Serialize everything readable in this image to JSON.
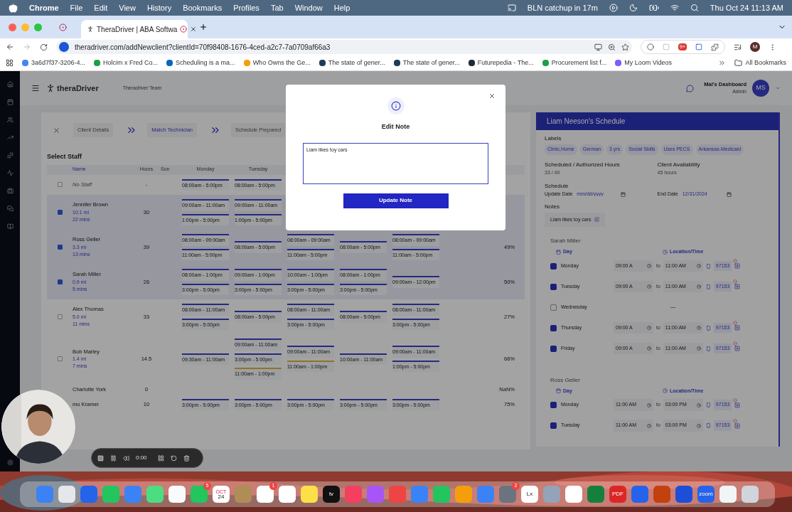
{
  "menubar": {
    "app": "Chrome",
    "menus": [
      "File",
      "Edit",
      "View",
      "History",
      "Bookmarks",
      "Profiles",
      "Tab",
      "Window",
      "Help"
    ],
    "event": "BLN catchup in 17m",
    "clock": "Thu Oct 24  11:13 AM"
  },
  "browser": {
    "tab": "TheraDriver | ABA Softwa",
    "url": "theradriver.com/addNewclient?clientId=70f98408-1676-4ced-a2c7-7a0709af66a3",
    "extension_badge": "9+",
    "profile": "M",
    "bookmarks": [
      {
        "label": "3a6d7f37-3206-4...",
        "color": "#4285f4"
      },
      {
        "label": "Holcim x Fred Co...",
        "color": "#1e9e4a"
      },
      {
        "label": "Scheduling is a ma...",
        "color": "#0a66c2"
      },
      {
        "label": "Who Owns the Ge...",
        "color": "#f59e0b"
      },
      {
        "label": "The state of gener...",
        "color": "#1f3a5f"
      },
      {
        "label": "The state of gener...",
        "color": "#1f3a5f"
      },
      {
        "label": "Futurepedia - The...",
        "color": "#1e293b"
      },
      {
        "label": "Procurement list f...",
        "color": "#1e9e4a"
      },
      {
        "label": "My Loom Videos",
        "color": "#7c5cff"
      }
    ],
    "all_bookmarks": "All Bookmarks"
  },
  "app": {
    "logo": "theraDriver",
    "team": "Theradriver Team",
    "user_name": "Mal's Dashboard",
    "user_role": "Admin",
    "initials": "MS"
  },
  "steps": [
    {
      "label": "Client Details",
      "selected": false
    },
    {
      "label": "Match Technician",
      "selected": true
    },
    {
      "label": "Schedule Prepared",
      "selected": false
    }
  ],
  "staff_table": {
    "title": "Select Staff",
    "columns": [
      "Name",
      "Hours",
      "Sun",
      "Monday",
      "Tuesday"
    ],
    "rows": [
      {
        "name": "No Staff",
        "hours": "-",
        "checked": false,
        "mon": [
          {
            "time": "08:00am - 5:00pm",
            "kind": "open"
          }
        ],
        "tue": [
          {
            "time": "08:00am - 5:00pm",
            "kind": "open"
          }
        ]
      },
      {
        "name": "Jennifer Brown",
        "distance": "10.1 mi",
        "travel": "22 mins",
        "hours": "30",
        "checked": true,
        "mon": [
          {
            "time": "09:00am - 11:00am",
            "kind": "open"
          },
          {
            "time": "1:00pm - 5:00pm",
            "kind": "open"
          }
        ],
        "tue": [
          {
            "time": "09:00am - 11:00am",
            "kind": "open"
          },
          {
            "time": "1:00pm - 5:00pm",
            "kind": "open"
          }
        ]
      },
      {
        "name": "Ross Geller",
        "distance": "3.3 mi",
        "travel": "13 mins",
        "hours": "39",
        "checked": true,
        "percent": "49%",
        "mon": [
          {
            "time": "08:00am - 09:00am",
            "kind": "open"
          },
          {
            "time": "11:00am - 5:00pm",
            "kind": "open"
          }
        ],
        "tue": [
          {
            "time": "08:00am - 5:00pm",
            "kind": "open"
          }
        ],
        "wed": [
          {
            "time": "08:00am - 09:00am",
            "kind": "open"
          },
          {
            "time": "11:00am - 5:00pm",
            "kind": "open"
          }
        ],
        "thu": [
          {
            "time": "08:00am - 5:00pm",
            "kind": "open"
          }
        ],
        "fri": [
          {
            "time": "08:00am - 09:00am",
            "kind": "open"
          },
          {
            "time": "11:00am - 5:00pm",
            "kind": "open"
          }
        ]
      },
      {
        "name": "Sarah Miller",
        "distance": "0.9 mi",
        "travel": "5 mins",
        "hours": "26",
        "checked": true,
        "percent": "50%",
        "mon": [
          {
            "time": "08:00am - 1:00pm",
            "kind": "open"
          },
          {
            "time": "3:00pm - 5:00pm",
            "kind": "open"
          }
        ],
        "tue": [
          {
            "time": "09:00am - 1:00pm",
            "kind": "open"
          },
          {
            "time": "3:00pm - 5:00pm",
            "kind": "open"
          }
        ],
        "wed": [
          {
            "time": "10:00am - 1:00pm",
            "kind": "open"
          },
          {
            "time": "3:00pm - 5:00pm",
            "kind": "open"
          }
        ],
        "thu": [
          {
            "time": "08:00am - 1:00pm",
            "kind": "open"
          },
          {
            "time": "3:00pm - 5:00pm",
            "kind": "open"
          }
        ],
        "fri": [
          {
            "time": "09:00am - 12:00pm",
            "kind": "open"
          }
        ]
      },
      {
        "name": "Alex Thomas",
        "distance": "5.0 mi",
        "travel": "11 mins",
        "hours": "33",
        "checked": false,
        "percent": "27%",
        "mon": [
          {
            "time": "08:00am - 11:00am",
            "kind": "open"
          },
          {
            "time": "3:00pm - 5:00pm",
            "kind": "open"
          }
        ],
        "tue": [
          {
            "time": "08:00am - 5:00pm",
            "kind": "open"
          }
        ],
        "wed": [
          {
            "time": "08:00am - 11:00am",
            "kind": "open"
          },
          {
            "time": "3:00pm - 5:00pm",
            "kind": "open"
          }
        ],
        "thu": [
          {
            "time": "08:00am - 5:00pm",
            "kind": "open"
          }
        ],
        "fri": [
          {
            "time": "08:00am - 11:00am",
            "kind": "open"
          },
          {
            "time": "3:00pm - 5:00pm",
            "kind": "open"
          }
        ]
      },
      {
        "name": "Bob Marley",
        "distance": "1.4 mi",
        "travel": "7 mins",
        "hours": "14.5",
        "checked": false,
        "percent": "66%",
        "mon": [
          {
            "time": "09:30am - 11:00am",
            "kind": "open"
          }
        ],
        "tue": [
          {
            "time": "09:00am - 11:00am",
            "kind": "open"
          },
          {
            "time": "3:00pm - 5:00pm",
            "kind": "open"
          },
          {
            "time": "11:00am - 1:00pm",
            "kind": "booked"
          }
        ],
        "wed": [
          {
            "time": "09:00am - 11:00am",
            "kind": "open"
          },
          {
            "time": "11:00am - 1:00pm",
            "kind": "booked"
          }
        ],
        "thu": [
          {
            "time": "10:00am - 11:00am",
            "kind": "open"
          }
        ],
        "fri": [
          {
            "time": "09:00am - 11:00am",
            "kind": "open"
          },
          {
            "time": "1:00pm - 5:00pm",
            "kind": "open"
          }
        ]
      },
      {
        "name": "Charlotte York",
        "hours": "0",
        "percent": "NaN%"
      },
      {
        "name": "mo Kramer",
        "hours": "10",
        "percent": "75%",
        "mon": [
          {
            "time": "3:00pm - 5:00pm",
            "kind": "open"
          }
        ],
        "tue": [
          {
            "time": "3:00pm - 5:00pm",
            "kind": "open"
          }
        ],
        "wed": [
          {
            "time": "3:00pm - 5:00pm",
            "kind": "open"
          }
        ],
        "thu": [
          {
            "time": "3:00pm - 5:00pm",
            "kind": "open"
          }
        ],
        "fri": [
          {
            "time": "3:00pm - 5:00pm",
            "kind": "open"
          }
        ]
      }
    ]
  },
  "schedule": {
    "title": "Liam Neeson's Schedule",
    "labels_heading": "Labels",
    "labels": [
      "Clinic,Home",
      "German",
      "3 yrs",
      "Social Skills",
      "Uses PECS",
      "Arkansas-Medicaid"
    ],
    "hours_label": "Scheduled / Authorized Hours",
    "hours": "33 / 40",
    "availability_label": "Client Availability",
    "availability": "45 hours",
    "schedule_heading": "Schedule",
    "update_date_label": "Update Date",
    "update_date_placeholder": "mm/dd/yyyy",
    "end_date_label": "End Date",
    "end_date": "12/31/2024",
    "notes_heading": "Notes",
    "note": "Liam likes toy cars",
    "staff": [
      {
        "name": "Sarah Miller",
        "day_heading": "Day",
        "location_heading": "Location/Time",
        "days": [
          {
            "day": "Monday",
            "checked": true,
            "from": "09:00 A",
            "to_word": "to",
            "to": "11:00 AM",
            "code": "97153"
          },
          {
            "day": "Tuesday",
            "checked": true,
            "from": "09:00 A",
            "to_word": "to",
            "to": "11:00 AM",
            "code": "97153"
          },
          {
            "day": "Wednesday",
            "checked": false,
            "empty": "—"
          },
          {
            "day": "Thursday",
            "checked": true,
            "from": "09:00 A",
            "to_word": "to",
            "to": "11:00 AM",
            "code": "97153"
          },
          {
            "day": "Friday",
            "checked": true,
            "from": "09:00 A",
            "to_word": "to",
            "to": "11:00 AM",
            "code": "97153"
          }
        ]
      },
      {
        "name": "Ross Geller",
        "day_heading": "Day",
        "location_heading": "Location/Time",
        "days": [
          {
            "day": "Monday",
            "checked": true,
            "from": "11:00 AM",
            "to_word": "to",
            "to": "03:00 PM",
            "code": "97153"
          },
          {
            "day": "Tuesday",
            "checked": true,
            "from": "11:00 AM",
            "to_word": "to",
            "to": "03:00 PM",
            "code": "97153"
          }
        ]
      }
    ]
  },
  "modal": {
    "title": "Edit Note",
    "value": "Liam likes toy cars",
    "button": "Update Note"
  },
  "recorder": {
    "time": "0:00"
  },
  "dock": [
    {
      "color": "#3b82f6"
    },
    {
      "color": "#e5e7eb"
    },
    {
      "color": "#2563eb"
    },
    {
      "color": "#22c55e"
    },
    {
      "color": "#3b82f6"
    },
    {
      "color": "#4ade80"
    },
    {
      "color": "#f9fafb"
    },
    {
      "color": "#22c55e",
      "badge": "5"
    },
    {
      "color": "#ffffff",
      "top": "OCT",
      "label": "24"
    },
    {
      "color": "#b08d57"
    },
    {
      "color": "#ffffff",
      "badge": "1"
    },
    {
      "color": "#ffffff"
    },
    {
      "color": "#fde047"
    },
    {
      "color": "#111111",
      "label": "tv"
    },
    {
      "color": "#f43f5e"
    },
    {
      "color": "#a855f7"
    },
    {
      "color": "#ef4444"
    },
    {
      "color": "#3b82f6"
    },
    {
      "color": "#22c55e"
    },
    {
      "color": "#f59e0b"
    },
    {
      "color": "#3b82f6"
    },
    {
      "color": "#6b7280",
      "badge": "2"
    },
    {
      "color": "#ffffff",
      "label": "Lx"
    },
    {
      "color": "#94a3b8"
    },
    {
      "color": "#ffffff"
    },
    {
      "color": "#15803d"
    },
    {
      "color": "#dc2626",
      "label": "PDF"
    },
    {
      "color": "#2563eb"
    },
    {
      "color": "#c2410c"
    },
    {
      "color": "#1d4ed8"
    },
    {
      "color": "#2563eb",
      "label": "zoom"
    },
    {
      "color": "#f3f4f6"
    },
    {
      "color": "#d1d5db"
    }
  ]
}
